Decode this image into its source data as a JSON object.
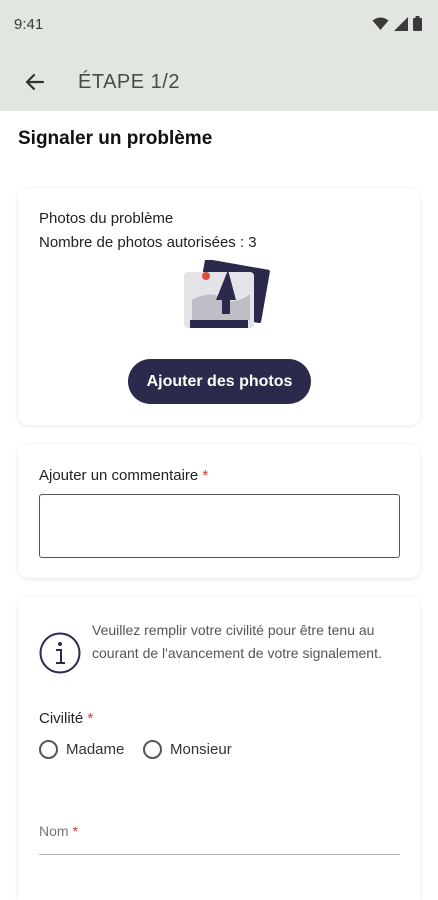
{
  "status_bar": {
    "time": "9:41"
  },
  "app_bar": {
    "title": "ÉTAPE 1/2"
  },
  "page": {
    "title": "Signaler un problème"
  },
  "photos": {
    "label": "Photos du problème",
    "count_text": "Nombre de photos autorisées : 3",
    "add_button": "Ajouter des photos"
  },
  "comment": {
    "label": "Ajouter un commentaire",
    "required_mark": "*",
    "value": ""
  },
  "civility": {
    "info_text": "Veuillez remplir votre civilité pour être tenu au courant de l'avancement de votre signalement.",
    "label": "Civilité",
    "required_mark": "*",
    "options": [
      "Madame",
      "Monsieur"
    ]
  },
  "name_field": {
    "label": "Nom",
    "required_mark": "*"
  },
  "colors": {
    "primary": "#2b2a4c",
    "app_bar_bg": "#e2e6e0",
    "required": "#dd3333"
  }
}
